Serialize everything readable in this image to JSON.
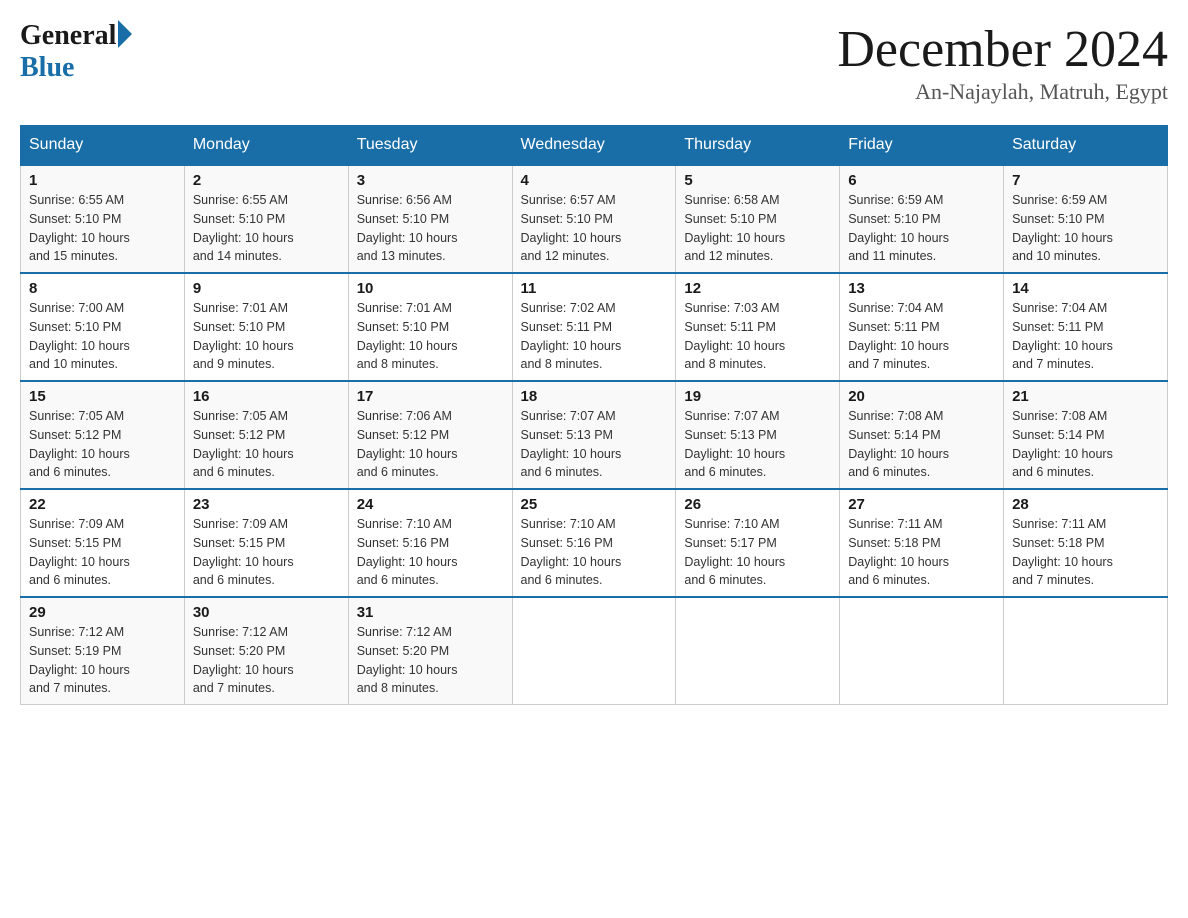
{
  "logo": {
    "general": "General",
    "blue": "Blue"
  },
  "title": "December 2024",
  "subtitle": "An-Najaylah, Matruh, Egypt",
  "days": [
    "Sunday",
    "Monday",
    "Tuesday",
    "Wednesday",
    "Thursday",
    "Friday",
    "Saturday"
  ],
  "weeks": [
    [
      {
        "day": "1",
        "sunrise": "6:55 AM",
        "sunset": "5:10 PM",
        "daylight": "10 hours and 15 minutes."
      },
      {
        "day": "2",
        "sunrise": "6:55 AM",
        "sunset": "5:10 PM",
        "daylight": "10 hours and 14 minutes."
      },
      {
        "day": "3",
        "sunrise": "6:56 AM",
        "sunset": "5:10 PM",
        "daylight": "10 hours and 13 minutes."
      },
      {
        "day": "4",
        "sunrise": "6:57 AM",
        "sunset": "5:10 PM",
        "daylight": "10 hours and 12 minutes."
      },
      {
        "day": "5",
        "sunrise": "6:58 AM",
        "sunset": "5:10 PM",
        "daylight": "10 hours and 12 minutes."
      },
      {
        "day": "6",
        "sunrise": "6:59 AM",
        "sunset": "5:10 PM",
        "daylight": "10 hours and 11 minutes."
      },
      {
        "day": "7",
        "sunrise": "6:59 AM",
        "sunset": "5:10 PM",
        "daylight": "10 hours and 10 minutes."
      }
    ],
    [
      {
        "day": "8",
        "sunrise": "7:00 AM",
        "sunset": "5:10 PM",
        "daylight": "10 hours and 10 minutes."
      },
      {
        "day": "9",
        "sunrise": "7:01 AM",
        "sunset": "5:10 PM",
        "daylight": "10 hours and 9 minutes."
      },
      {
        "day": "10",
        "sunrise": "7:01 AM",
        "sunset": "5:10 PM",
        "daylight": "10 hours and 8 minutes."
      },
      {
        "day": "11",
        "sunrise": "7:02 AM",
        "sunset": "5:11 PM",
        "daylight": "10 hours and 8 minutes."
      },
      {
        "day": "12",
        "sunrise": "7:03 AM",
        "sunset": "5:11 PM",
        "daylight": "10 hours and 8 minutes."
      },
      {
        "day": "13",
        "sunrise": "7:04 AM",
        "sunset": "5:11 PM",
        "daylight": "10 hours and 7 minutes."
      },
      {
        "day": "14",
        "sunrise": "7:04 AM",
        "sunset": "5:11 PM",
        "daylight": "10 hours and 7 minutes."
      }
    ],
    [
      {
        "day": "15",
        "sunrise": "7:05 AM",
        "sunset": "5:12 PM",
        "daylight": "10 hours and 6 minutes."
      },
      {
        "day": "16",
        "sunrise": "7:05 AM",
        "sunset": "5:12 PM",
        "daylight": "10 hours and 6 minutes."
      },
      {
        "day": "17",
        "sunrise": "7:06 AM",
        "sunset": "5:12 PM",
        "daylight": "10 hours and 6 minutes."
      },
      {
        "day": "18",
        "sunrise": "7:07 AM",
        "sunset": "5:13 PM",
        "daylight": "10 hours and 6 minutes."
      },
      {
        "day": "19",
        "sunrise": "7:07 AM",
        "sunset": "5:13 PM",
        "daylight": "10 hours and 6 minutes."
      },
      {
        "day": "20",
        "sunrise": "7:08 AM",
        "sunset": "5:14 PM",
        "daylight": "10 hours and 6 minutes."
      },
      {
        "day": "21",
        "sunrise": "7:08 AM",
        "sunset": "5:14 PM",
        "daylight": "10 hours and 6 minutes."
      }
    ],
    [
      {
        "day": "22",
        "sunrise": "7:09 AM",
        "sunset": "5:15 PM",
        "daylight": "10 hours and 6 minutes."
      },
      {
        "day": "23",
        "sunrise": "7:09 AM",
        "sunset": "5:15 PM",
        "daylight": "10 hours and 6 minutes."
      },
      {
        "day": "24",
        "sunrise": "7:10 AM",
        "sunset": "5:16 PM",
        "daylight": "10 hours and 6 minutes."
      },
      {
        "day": "25",
        "sunrise": "7:10 AM",
        "sunset": "5:16 PM",
        "daylight": "10 hours and 6 minutes."
      },
      {
        "day": "26",
        "sunrise": "7:10 AM",
        "sunset": "5:17 PM",
        "daylight": "10 hours and 6 minutes."
      },
      {
        "day": "27",
        "sunrise": "7:11 AM",
        "sunset": "5:18 PM",
        "daylight": "10 hours and 6 minutes."
      },
      {
        "day": "28",
        "sunrise": "7:11 AM",
        "sunset": "5:18 PM",
        "daylight": "10 hours and 7 minutes."
      }
    ],
    [
      {
        "day": "29",
        "sunrise": "7:12 AM",
        "sunset": "5:19 PM",
        "daylight": "10 hours and 7 minutes."
      },
      {
        "day": "30",
        "sunrise": "7:12 AM",
        "sunset": "5:20 PM",
        "daylight": "10 hours and 7 minutes."
      },
      {
        "day": "31",
        "sunrise": "7:12 AM",
        "sunset": "5:20 PM",
        "daylight": "10 hours and 8 minutes."
      },
      null,
      null,
      null,
      null
    ]
  ],
  "labels": {
    "sunrise": "Sunrise:",
    "sunset": "Sunset:",
    "daylight": "Daylight:"
  }
}
